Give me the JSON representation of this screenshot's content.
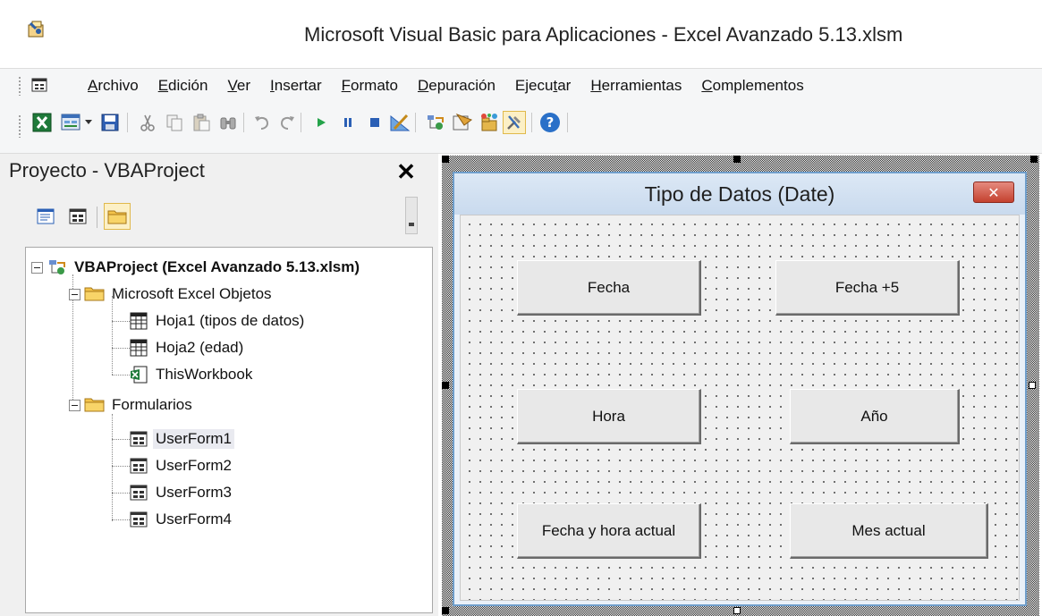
{
  "window": {
    "title": "Microsoft Visual Basic para Aplicaciones - Excel Avanzado 5.13.xlsm"
  },
  "menubar": {
    "items": [
      {
        "label": "Archivo",
        "accel": "A",
        "rest": "rchivo"
      },
      {
        "label": "Edición",
        "accel": "E",
        "rest": "dición"
      },
      {
        "label": "Ver",
        "accel": "V",
        "rest": "er"
      },
      {
        "label": "Insertar",
        "accel": "I",
        "rest": "nsertar"
      },
      {
        "label": "Formato",
        "accel": "F",
        "rest": "ormato"
      },
      {
        "label": "Depuración",
        "accel": "D",
        "rest": "epuración"
      },
      {
        "label": "Ejecutar",
        "pre": "Ejecu",
        "accel": "t",
        "rest": "ar"
      },
      {
        "label": "Herramientas",
        "accel": "H",
        "rest": "erramientas"
      },
      {
        "label": "Complementos",
        "accel": "C",
        "rest": "omplementos"
      }
    ]
  },
  "toolbar": {
    "buttons": [
      {
        "icon": "excel-view-icon"
      },
      {
        "icon": "insert-userform-icon"
      },
      {
        "icon": "dropdown-arrow-icon"
      },
      {
        "icon": "save-icon"
      },
      {
        "icon": "cut-icon"
      },
      {
        "icon": "copy-icon"
      },
      {
        "icon": "paste-icon"
      },
      {
        "icon": "find-icon"
      },
      {
        "icon": "undo-icon"
      },
      {
        "icon": "redo-icon"
      },
      {
        "icon": "run-icon"
      },
      {
        "icon": "break-icon"
      },
      {
        "icon": "reset-icon"
      },
      {
        "icon": "design-mode-icon"
      },
      {
        "icon": "project-explorer-icon"
      },
      {
        "icon": "properties-window-icon"
      },
      {
        "icon": "object-browser-icon"
      },
      {
        "icon": "toolbox-icon"
      },
      {
        "icon": "help-icon"
      }
    ]
  },
  "project_panel": {
    "title": "Proyecto - VBAProject",
    "close_label": "✕",
    "tree": [
      {
        "label": "VBAProject (Excel Avanzado 5.13.xlsm)",
        "icon": "vbaproject-icon",
        "bold": true
      },
      {
        "label": "Microsoft Excel Objetos",
        "icon": "folder-icon"
      },
      {
        "label": "Hoja1 (tipos de datos)",
        "icon": "sheet-icon"
      },
      {
        "label": "Hoja2 (edad)",
        "icon": "sheet-icon"
      },
      {
        "label": "ThisWorkbook",
        "icon": "workbook-icon"
      },
      {
        "label": "Formularios",
        "icon": "folder-icon"
      },
      {
        "label": "UserForm1",
        "icon": "userform-icon",
        "selected": true
      },
      {
        "label": "UserForm2",
        "icon": "userform-icon"
      },
      {
        "label": "UserForm3",
        "icon": "userform-icon"
      },
      {
        "label": "UserForm4",
        "icon": "userform-icon"
      }
    ]
  },
  "userform": {
    "title": "Tipo de Datos (Date)",
    "close_label": "✕",
    "buttons": [
      {
        "label": "Fecha"
      },
      {
        "label": "Fecha +5"
      },
      {
        "label": "Hora"
      },
      {
        "label": "Año"
      },
      {
        "label": "Fecha y hora actual"
      },
      {
        "label": "Mes actual"
      }
    ]
  },
  "colors": {
    "form_border": "#6f9ecb",
    "close_red": "#c4412f",
    "highlight": "#fcf0c6"
  }
}
